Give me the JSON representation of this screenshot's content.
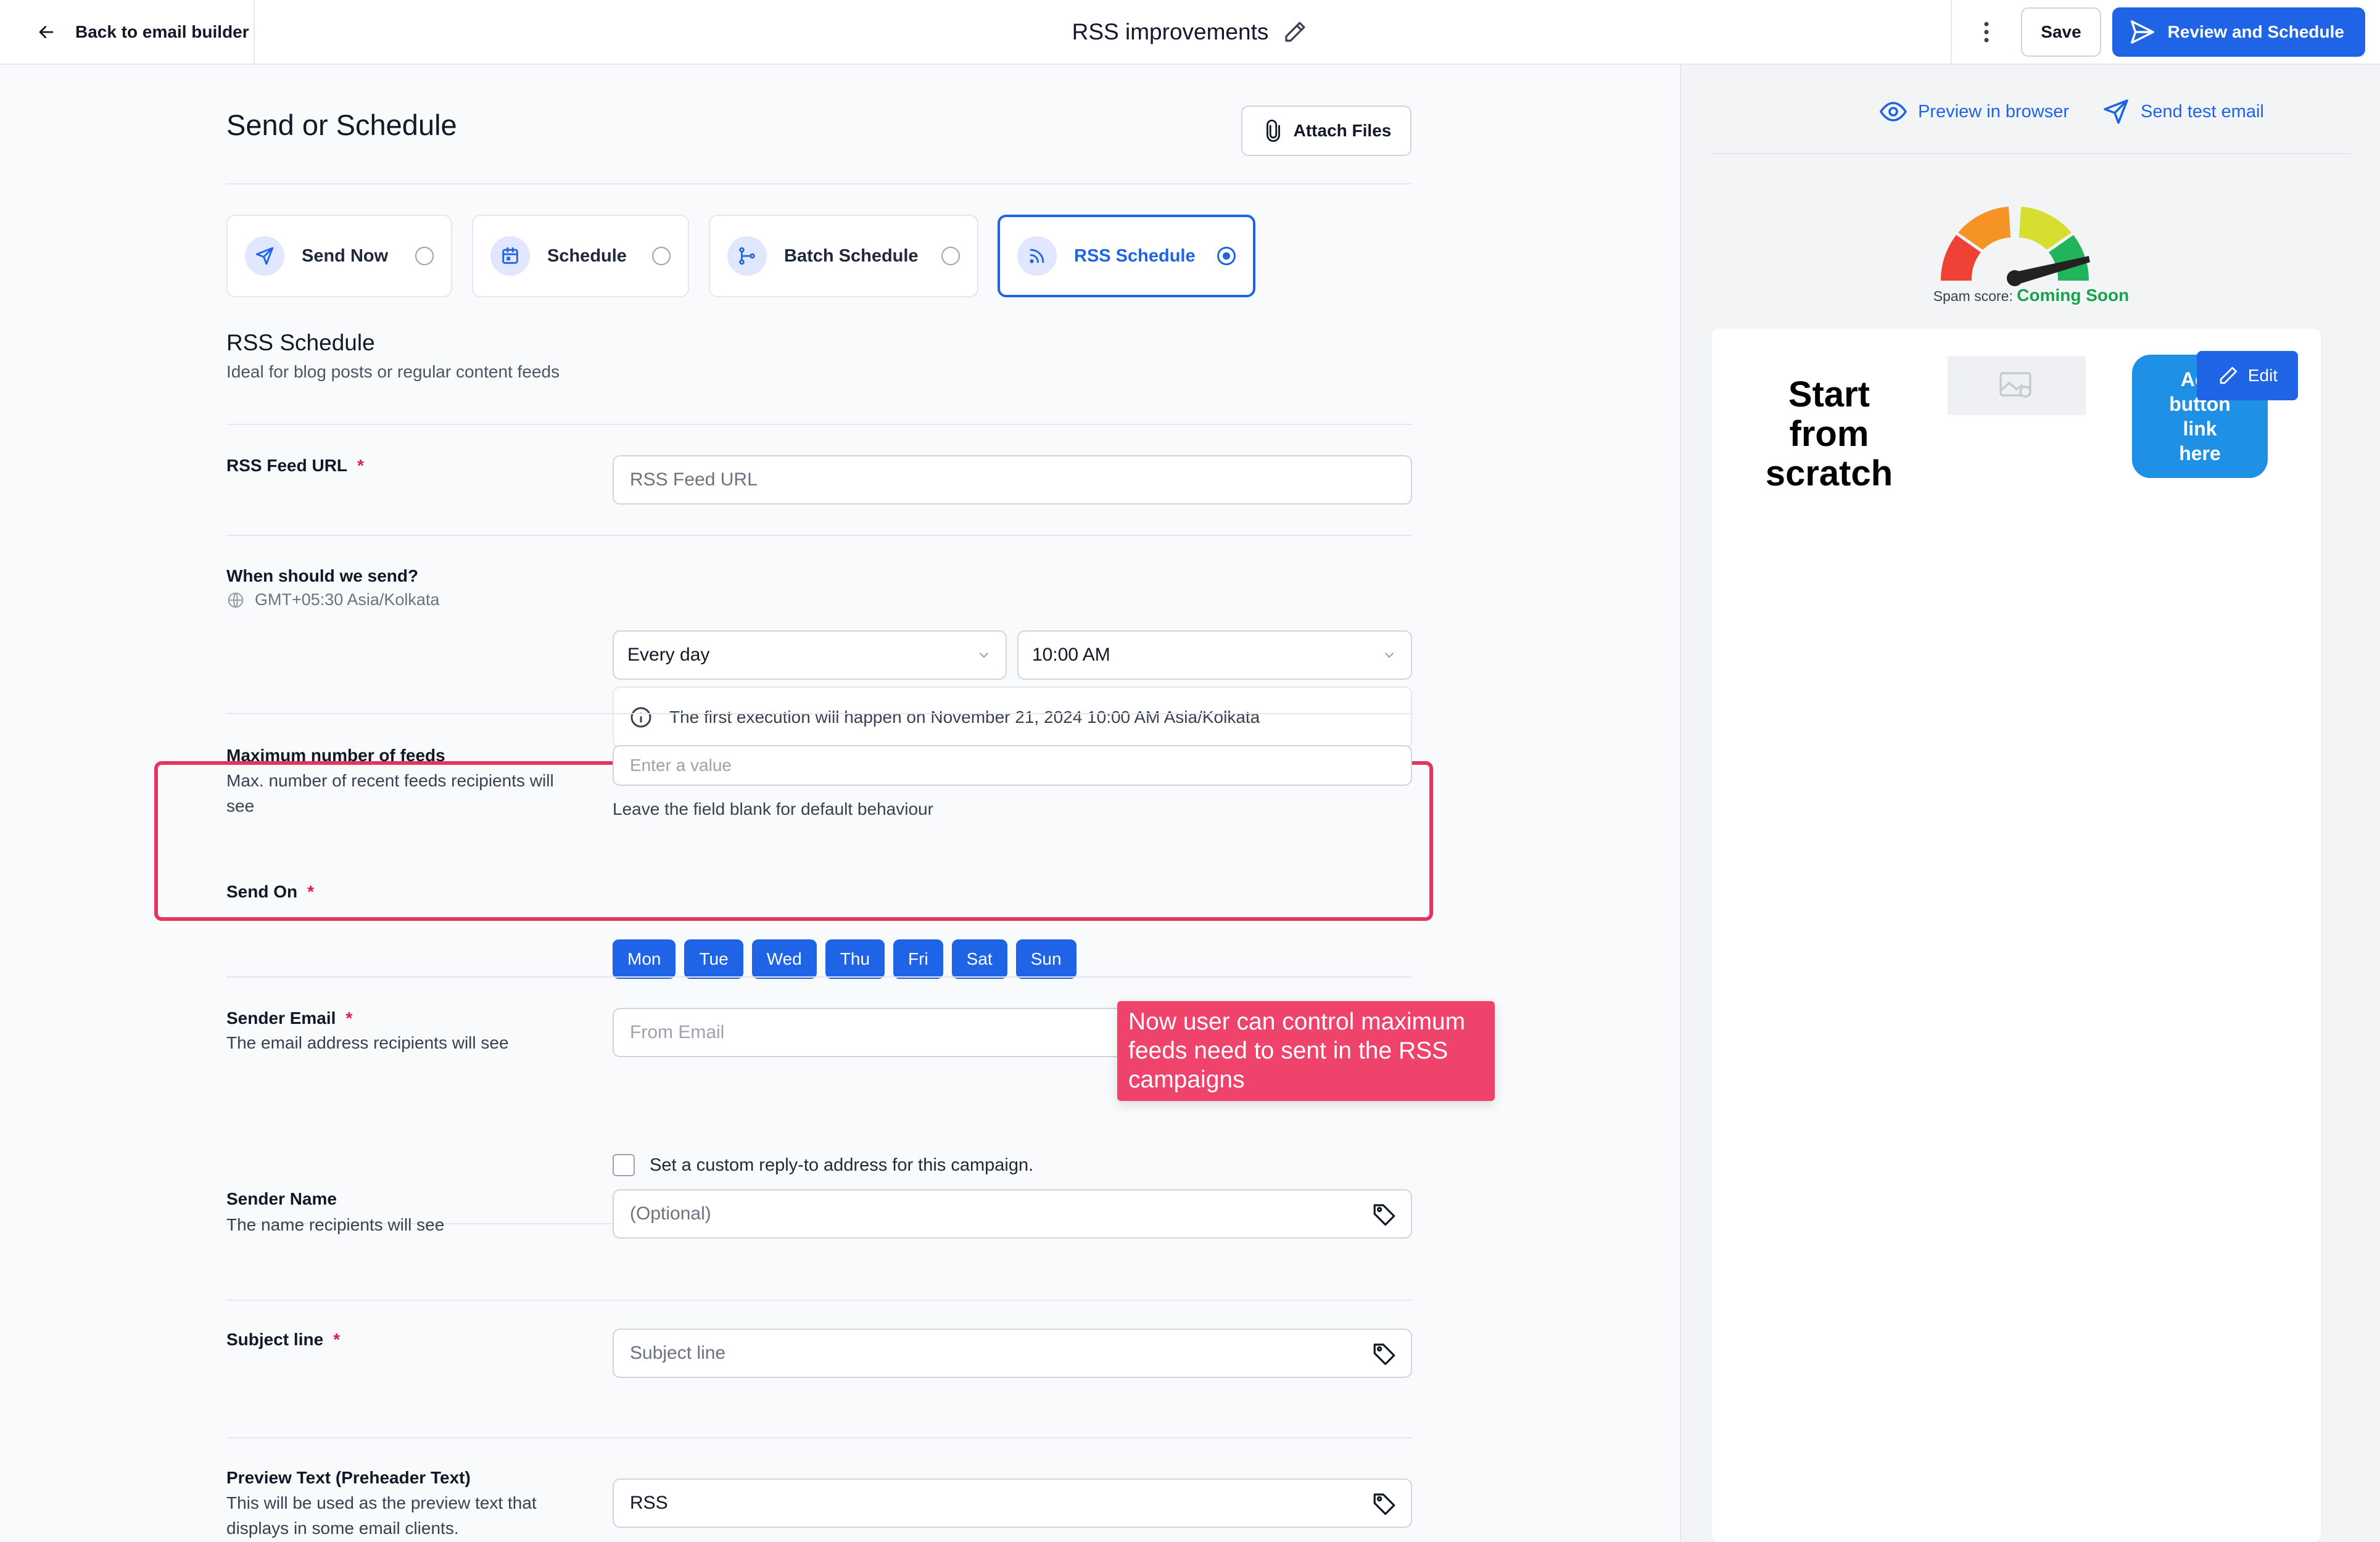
{
  "header": {
    "back_label": "Back to email builder",
    "title": "RSS improvements",
    "save_label": "Save",
    "review_label": "Review and Schedule"
  },
  "main": {
    "heading": "Send or Schedule",
    "attach_label": "Attach Files",
    "modes": [
      {
        "label": "Send Now",
        "icon": "send-icon",
        "selected": false
      },
      {
        "label": "Schedule",
        "icon": "calendar-icon",
        "selected": false
      },
      {
        "label": "Batch Schedule",
        "icon": "batch-icon",
        "selected": false
      },
      {
        "label": "RSS Schedule",
        "icon": "rss-icon",
        "selected": true
      }
    ],
    "section_title": "RSS Schedule",
    "section_sub": "Ideal for blog posts or regular content feeds",
    "rss_url": {
      "label": "RSS Feed URL",
      "required": "*",
      "placeholder": "RSS Feed URL"
    },
    "when": {
      "label": "When should we send?",
      "timezone": "GMT+05:30 Asia/Kolkata",
      "frequency": "Every day",
      "time": "10:00 AM",
      "info": "The first execution will happen on November 21, 2024 10:00 AM Asia/Kolkata"
    },
    "max_feeds": {
      "label": "Maximum number of feeds",
      "help": "Max. number of recent feeds recipients will see",
      "placeholder": "Enter a value",
      "hint": "Leave the field blank for default behaviour"
    },
    "send_on": {
      "label": "Send On",
      "required": "*",
      "days": [
        "Mon",
        "Tue",
        "Wed",
        "Thu",
        "Fri",
        "Sat",
        "Sun"
      ]
    },
    "callout": "Now user can control maximum feeds need to sent in the RSS campaigns",
    "sender_email": {
      "label": "Sender Email",
      "required": "*",
      "help": "The email address recipients will see",
      "placeholder": "From Email",
      "reply_to": "Set a custom reply-to address for this campaign."
    },
    "sender_name": {
      "label": "Sender Name",
      "help": "The name recipients will see",
      "placeholder": "(Optional)"
    },
    "subject": {
      "label": "Subject line",
      "required": "*",
      "placeholder": "Subject line"
    },
    "preview_text": {
      "label": "Preview Text (Preheader Text)",
      "help": "This will be used as the preview text that displays in some email clients.",
      "value": "RSS"
    }
  },
  "preview": {
    "browser_label": "Preview in browser",
    "test_label": "Send test email",
    "spam_label": "Spam score:",
    "spam_value": "Coming Soon",
    "scratch_text": "Start from scratch",
    "button_text": "Add button link here",
    "edit_label": "Edit"
  },
  "colors": {
    "accent": "#1f64e6",
    "highlight": "#e5355f",
    "callout": "#f0436b",
    "spam_ok": "#16a34a"
  }
}
